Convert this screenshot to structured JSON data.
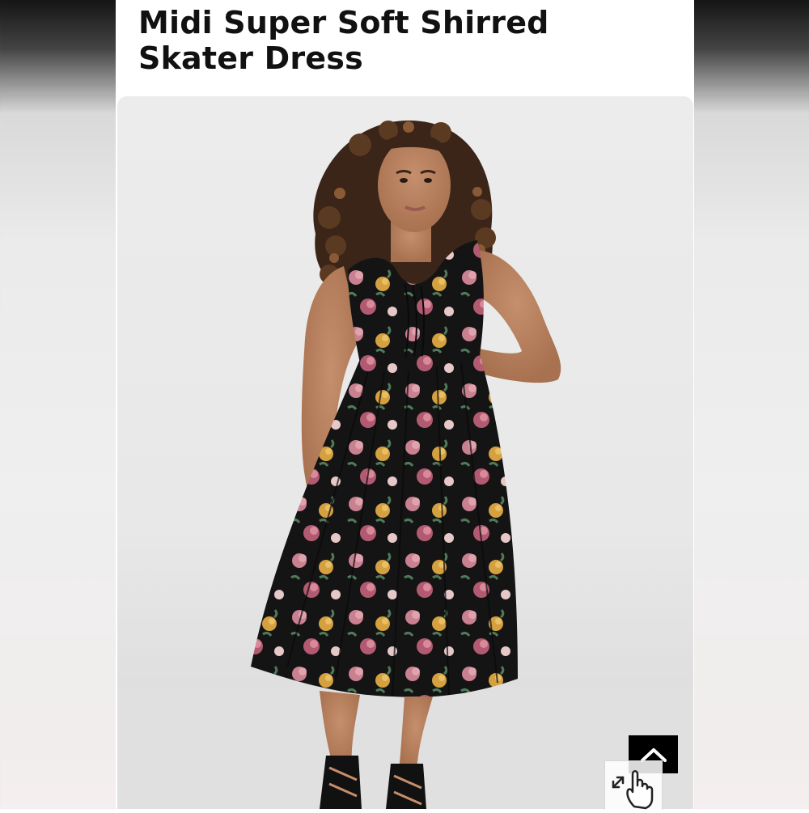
{
  "product": {
    "title": "Midi Super Soft Shirred Skater Dress"
  },
  "image": {
    "subject": "model-wearing-black-floral-midi-dress"
  },
  "controls": {
    "scroll_top_icon": "chevron-up-icon",
    "zoom_hand_icon": "pointer-hand-expand-icon"
  },
  "colors": {
    "title_text": "#111111",
    "dress_base": "#151414",
    "accent_floral_pink": "#c98090",
    "accent_floral_gold": "#d4a040",
    "button_bg": "#000000"
  }
}
